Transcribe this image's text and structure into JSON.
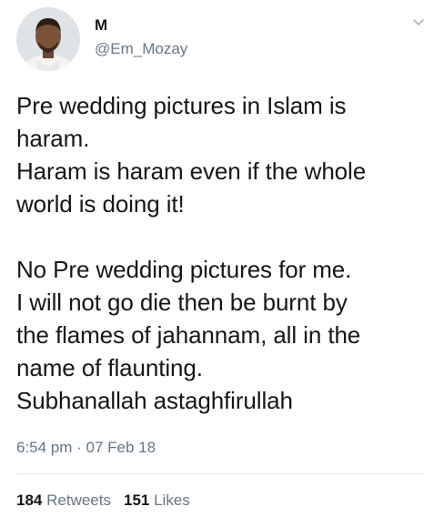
{
  "author": {
    "display_name": "M",
    "handle": "@Em_Mozay",
    "avatar_icon": "profile-photo-avatar"
  },
  "menu_icon": "chevron-down-icon",
  "tweet": {
    "lines_para1": [
      "Pre wedding pictures in Islam is",
      "haram.",
      "Haram is haram even if the whole",
      "world is doing it!"
    ],
    "lines_para2": [
      "No Pre wedding pictures for me.",
      "I will not go die then be burnt by",
      "the flames of jahannam, all in the",
      "name of flaunting.",
      "Subhanallah astaghfirullah"
    ],
    "timestamp": "6:54 pm · 07 Feb 18"
  },
  "stats": {
    "retweets_count": "184",
    "retweets_label": "Retweets",
    "likes_count": "151",
    "likes_label": "Likes"
  },
  "colors": {
    "text": "#14171a",
    "secondary": "#657786",
    "divider": "#e1e8ed",
    "background": "#ffffff"
  }
}
